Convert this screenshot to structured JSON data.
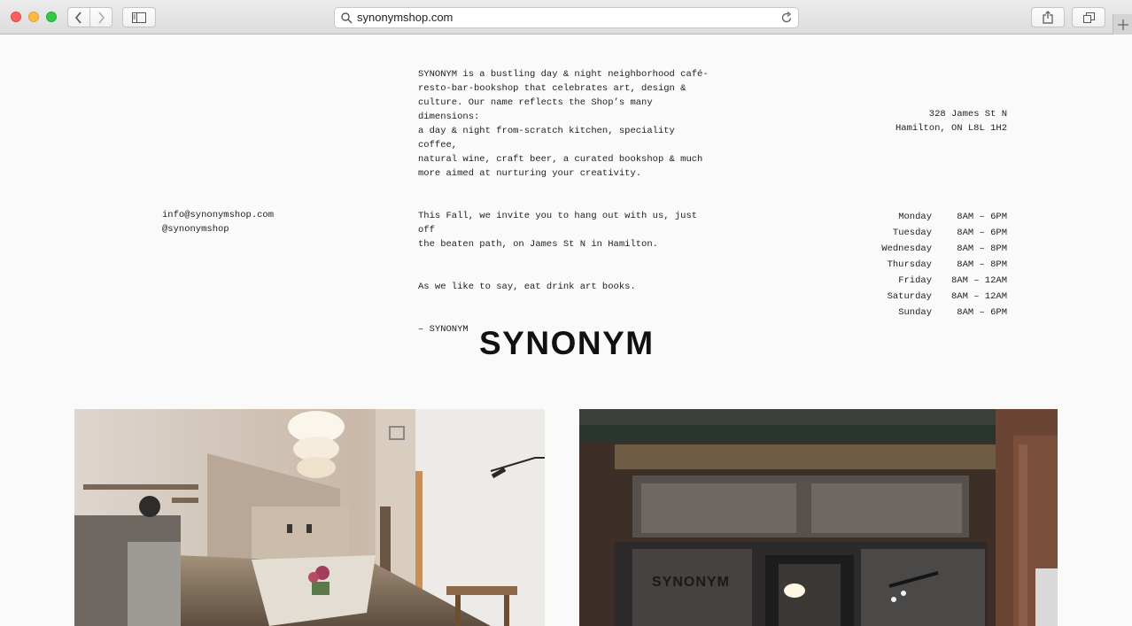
{
  "browser": {
    "url": "synonymshop.com",
    "icons": {
      "back": "chevron-left-icon",
      "forward": "chevron-right-icon",
      "sidebar": "sidebar-icon",
      "search": "search-icon",
      "reload": "reload-icon",
      "share": "share-icon",
      "tabs": "tabs-overview-icon",
      "new_tab": "plus-icon"
    }
  },
  "about": {
    "paragraphs": [
      "SYNONYM is a bustling day & night neighborhood café-\nresto-bar-bookshop that celebrates art, design &\nculture. Our name reflects the Shop’s many dimensions:\na day & night from-scratch kitchen, speciality coffee,\nnatural wine, craft beer, a curated bookshop & much\nmore aimed at nurturing your creativity.",
      "This Fall, we invite you to hang out with us, just off\nthe beaten path, on James St N in Hamilton.",
      "As we like to say, eat drink art books.",
      "– SYNONYM"
    ]
  },
  "contact": {
    "email": "info@synonymshop.com",
    "social": "@synonymshop"
  },
  "location": {
    "line1": "328 James St N",
    "line2": "Hamilton, ON L8L 1H2"
  },
  "hours": [
    {
      "day": "Monday",
      "time": "8AM – 6PM"
    },
    {
      "day": "Tuesday",
      "time": "8AM – 6PM"
    },
    {
      "day": "Wednesday",
      "time": "8AM – 8PM"
    },
    {
      "day": "Thursday",
      "time": "8AM – 8PM"
    },
    {
      "day": "Friday",
      "time": "8AM – 12AM"
    },
    {
      "day": "Saturday",
      "time": "8AM – 12AM"
    },
    {
      "day": "Sunday",
      "time": "8AM – 6PM"
    }
  ],
  "logo": "SYNONYM",
  "storefront_sign": "SYNONYM",
  "colors": {
    "page_bg": "#fafafa",
    "text": "#222222"
  }
}
